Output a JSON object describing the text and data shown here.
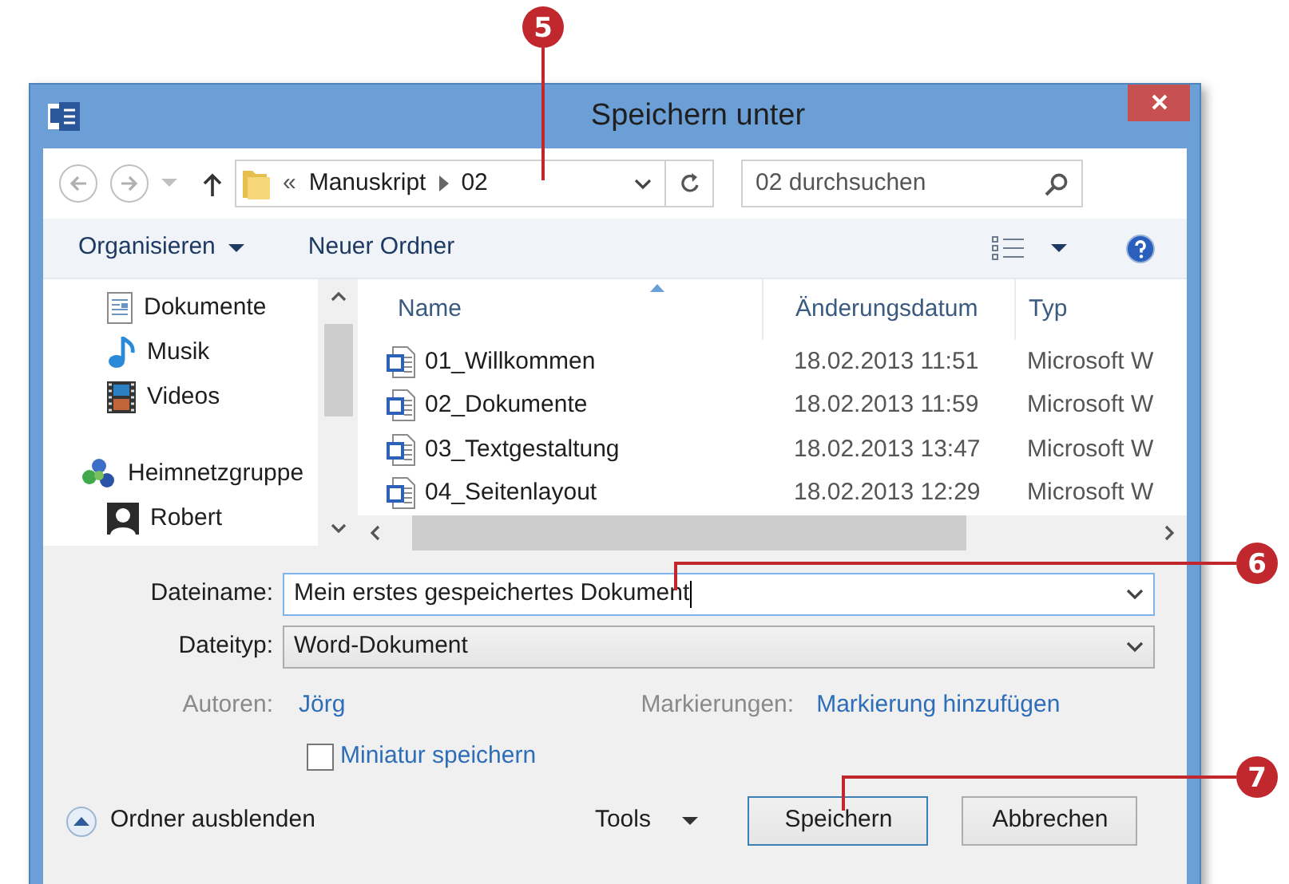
{
  "callouts": [
    {
      "label": "5"
    },
    {
      "label": "6"
    },
    {
      "label": "7"
    }
  ],
  "window": {
    "title": "Speichern unter"
  },
  "address_bar": {
    "overflow": "«",
    "path": [
      "Manuskript",
      "02"
    ]
  },
  "search": {
    "placeholder": "02 durchsuchen"
  },
  "toolbar": {
    "organize": "Organisieren",
    "new_folder": "Neuer Ordner"
  },
  "sidebar": {
    "items": [
      {
        "label": "Dokumente",
        "kind": "documents"
      },
      {
        "label": "Musik",
        "kind": "music"
      },
      {
        "label": "Videos",
        "kind": "videos"
      },
      {
        "label": "Heimnetzgruppe",
        "kind": "homegroup"
      },
      {
        "label": "Robert",
        "kind": "user"
      }
    ]
  },
  "file_list": {
    "columns": [
      "Name",
      "Änderungsdatum",
      "Typ"
    ],
    "rows": [
      {
        "name": "01_Willkommen",
        "date": "18.02.2013 11:51",
        "type": "Microsoft W"
      },
      {
        "name": "02_Dokumente",
        "date": "18.02.2013 11:59",
        "type": "Microsoft W"
      },
      {
        "name": "03_Textgestaltung",
        "date": "18.02.2013 13:47",
        "type": "Microsoft W"
      },
      {
        "name": "04_Seitenlayout",
        "date": "18.02.2013 12:29",
        "type": "Microsoft W"
      }
    ]
  },
  "form": {
    "filename_label": "Dateiname:",
    "filename": "Mein erstes gespeichertes Dokument",
    "filetype_label": "Dateityp:",
    "filetype": "Word-Dokument",
    "authors_label": "Autoren:",
    "authors": "Jörg",
    "tags_label": "Markierungen:",
    "tags": "Markierung hinzufügen",
    "thumbnail": {
      "label": "Miniatur speichern",
      "checked": false
    }
  },
  "footer": {
    "hide_folders": "Ordner ausblenden",
    "tools": "Tools",
    "buttons": [
      {
        "label": "Speichern",
        "kind": "primary"
      },
      {
        "label": "Abbrechen",
        "kind": "secondary"
      }
    ]
  }
}
